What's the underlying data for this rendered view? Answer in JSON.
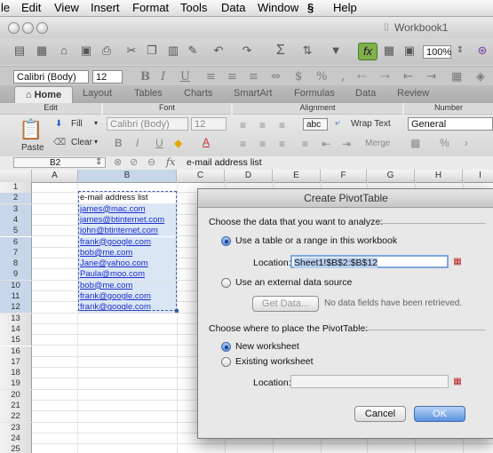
{
  "menubar": {
    "items": [
      "le",
      "Edit",
      "View",
      "Insert",
      "Format",
      "Tools",
      "Data",
      "Window",
      "Help"
    ],
    "script_icon": "script-icon"
  },
  "window": {
    "title": "Workbook1"
  },
  "format_bar": {
    "font": "Calibri (Body)",
    "size": "12",
    "zoom": "100%"
  },
  "ribbon": {
    "tabs": [
      "Home",
      "Layout",
      "Tables",
      "Charts",
      "SmartArt",
      "Formulas",
      "Data",
      "Review"
    ],
    "groups": {
      "edit": "Edit",
      "font": "Font",
      "alignment": "Alignment",
      "number": "Number"
    },
    "fill_label": "Fill",
    "clear_label": "Clear",
    "paste_label": "Paste",
    "font_name": "Calibri (Body)",
    "font_size": "12",
    "wrap_text": "Wrap Text",
    "merge": "Merge",
    "number_format": "General",
    "abc_label": "abc"
  },
  "formula_bar": {
    "cell_ref": "B2",
    "fx": "fx",
    "content": "e-mail address list"
  },
  "grid": {
    "columns": [
      "A",
      "B",
      "C",
      "D",
      "E",
      "F",
      "G",
      "H",
      "I"
    ],
    "rows": [
      "1",
      "2",
      "3",
      "4",
      "5",
      "6",
      "7",
      "8",
      "9",
      "10",
      "11",
      "12",
      "13",
      "14",
      "15",
      "16",
      "17",
      "18",
      "19",
      "20",
      "21",
      "22",
      "23",
      "24",
      "25"
    ],
    "b_header": "e-mail address list",
    "emails": [
      "james@mac.com",
      "james@btinternet.com",
      "john@btinternet.com",
      "frank@google.com",
      "bob@me.com",
      "Jane@yahoo.com",
      "Paula@moo.com",
      "bob@me.com",
      "frank@google.com",
      "frank@google.com"
    ]
  },
  "dialog": {
    "title": "Create PivotTable",
    "choose_data": "Choose the data that you want to analyze:",
    "use_table": "Use a table or a range in this workbook",
    "location_label": "Location:",
    "location_value": "Sheet1!$B$2:$B$12",
    "external_source": "Use an external data source",
    "get_data": "Get Data...",
    "no_fields": "No data fields have been retrieved.",
    "choose_place": "Choose where to place the PivotTable:",
    "new_worksheet": "New worksheet",
    "existing_worksheet": "Existing worksheet",
    "location2_label": "Location:",
    "cancel": "Cancel",
    "ok": "OK"
  }
}
